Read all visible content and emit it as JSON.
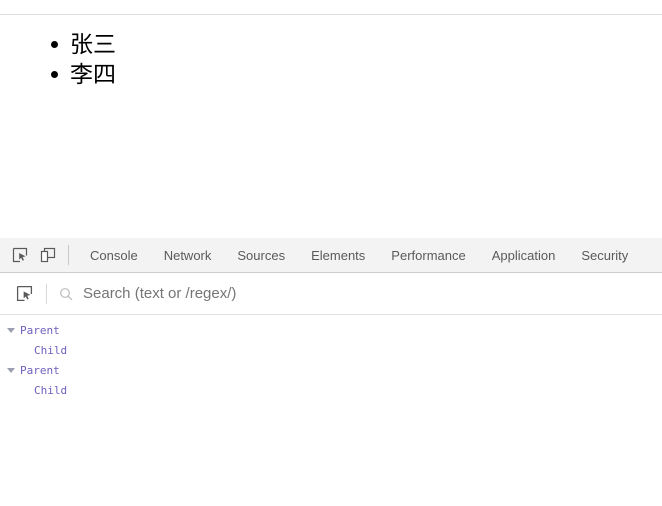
{
  "page": {
    "list_items": [
      {
        "text": "张三"
      },
      {
        "text": "李四"
      }
    ]
  },
  "devtools": {
    "toolbar": {
      "inspect_icon": "inspect-element-icon",
      "device_toggle_icon": "device-toolbar-icon"
    },
    "tabs": [
      {
        "label": "Console"
      },
      {
        "label": "Network"
      },
      {
        "label": "Sources"
      },
      {
        "label": "Elements"
      },
      {
        "label": "Performance"
      },
      {
        "label": "Application"
      },
      {
        "label": "Security"
      }
    ],
    "search": {
      "inspect_icon": "inspect-element-icon",
      "search_icon": "search-icon",
      "placeholder": "Search (text or /regex/)",
      "value": ""
    },
    "console_entries": [
      {
        "type": "group",
        "label": "Parent",
        "expanded": true
      },
      {
        "type": "child",
        "label": "Child"
      },
      {
        "type": "group",
        "label": "Parent",
        "expanded": true
      },
      {
        "type": "child",
        "label": "Child"
      }
    ],
    "colors": {
      "tabbar_background": "#f3f3f3",
      "tab_text": "#5a5a5a",
      "console_text": "#6f5fbd",
      "placeholder_text": "#757575",
      "divider": "#cdcdcd"
    }
  }
}
